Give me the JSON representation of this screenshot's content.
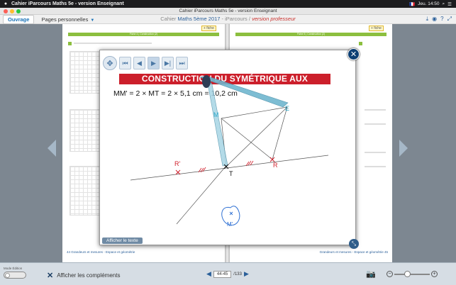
{
  "menubar": {
    "app_name": "Cahier iParcours Maths 5e - version Enseignant",
    "items": [],
    "clock": "Jeu. 14:50",
    "flag": "🇫🇷"
  },
  "window": {
    "title": "Cahier iParcours Maths 5e - version Enseignant"
  },
  "toolbar": {
    "tab_ouvrage": "Ouvrage",
    "tab_pages": "Pages personnelles",
    "title_prefix": "Cahier",
    "title_main": "Maths 5ème 2017",
    "title_sep": " - iParcours / ",
    "title_version": "version professeur"
  },
  "pages": {
    "left_header": "Fiche 4 | Construction (2)",
    "right_header": "Fiche 5 | Construction (2)",
    "fiche_label": "+ fiche",
    "left_footer": "Grandeurs et mesures - Espace et géométrie",
    "right_footer": "Grandeurs et mesures - Espace et géométrie",
    "left_num": "44",
    "right_num": "45"
  },
  "overlay": {
    "title": "CONSTRUCTION DU SYMÉTRIQUE AUX INSTRUMENTS",
    "formula": "MM' = 2 × MT = 2 × 5,1 cm = 10,2 cm",
    "afficher_texte": "Afficher le texte",
    "points": {
      "M": "M",
      "E": "E",
      "T": "T",
      "R": "R",
      "R_prime": "R'",
      "M_prime": "M'"
    },
    "colors": {
      "banner": "#cc1f2b",
      "construct_red": "#d11f2b",
      "construct_cyan": "#2aa7c9",
      "instrument": "#6fb6cf",
      "point_blue": "#2d6fd3"
    }
  },
  "bottombar": {
    "mode_label": "Mode Édition",
    "complements_label": "Afficher les compléments",
    "page_current": "44-45",
    "page_total": "/133"
  }
}
